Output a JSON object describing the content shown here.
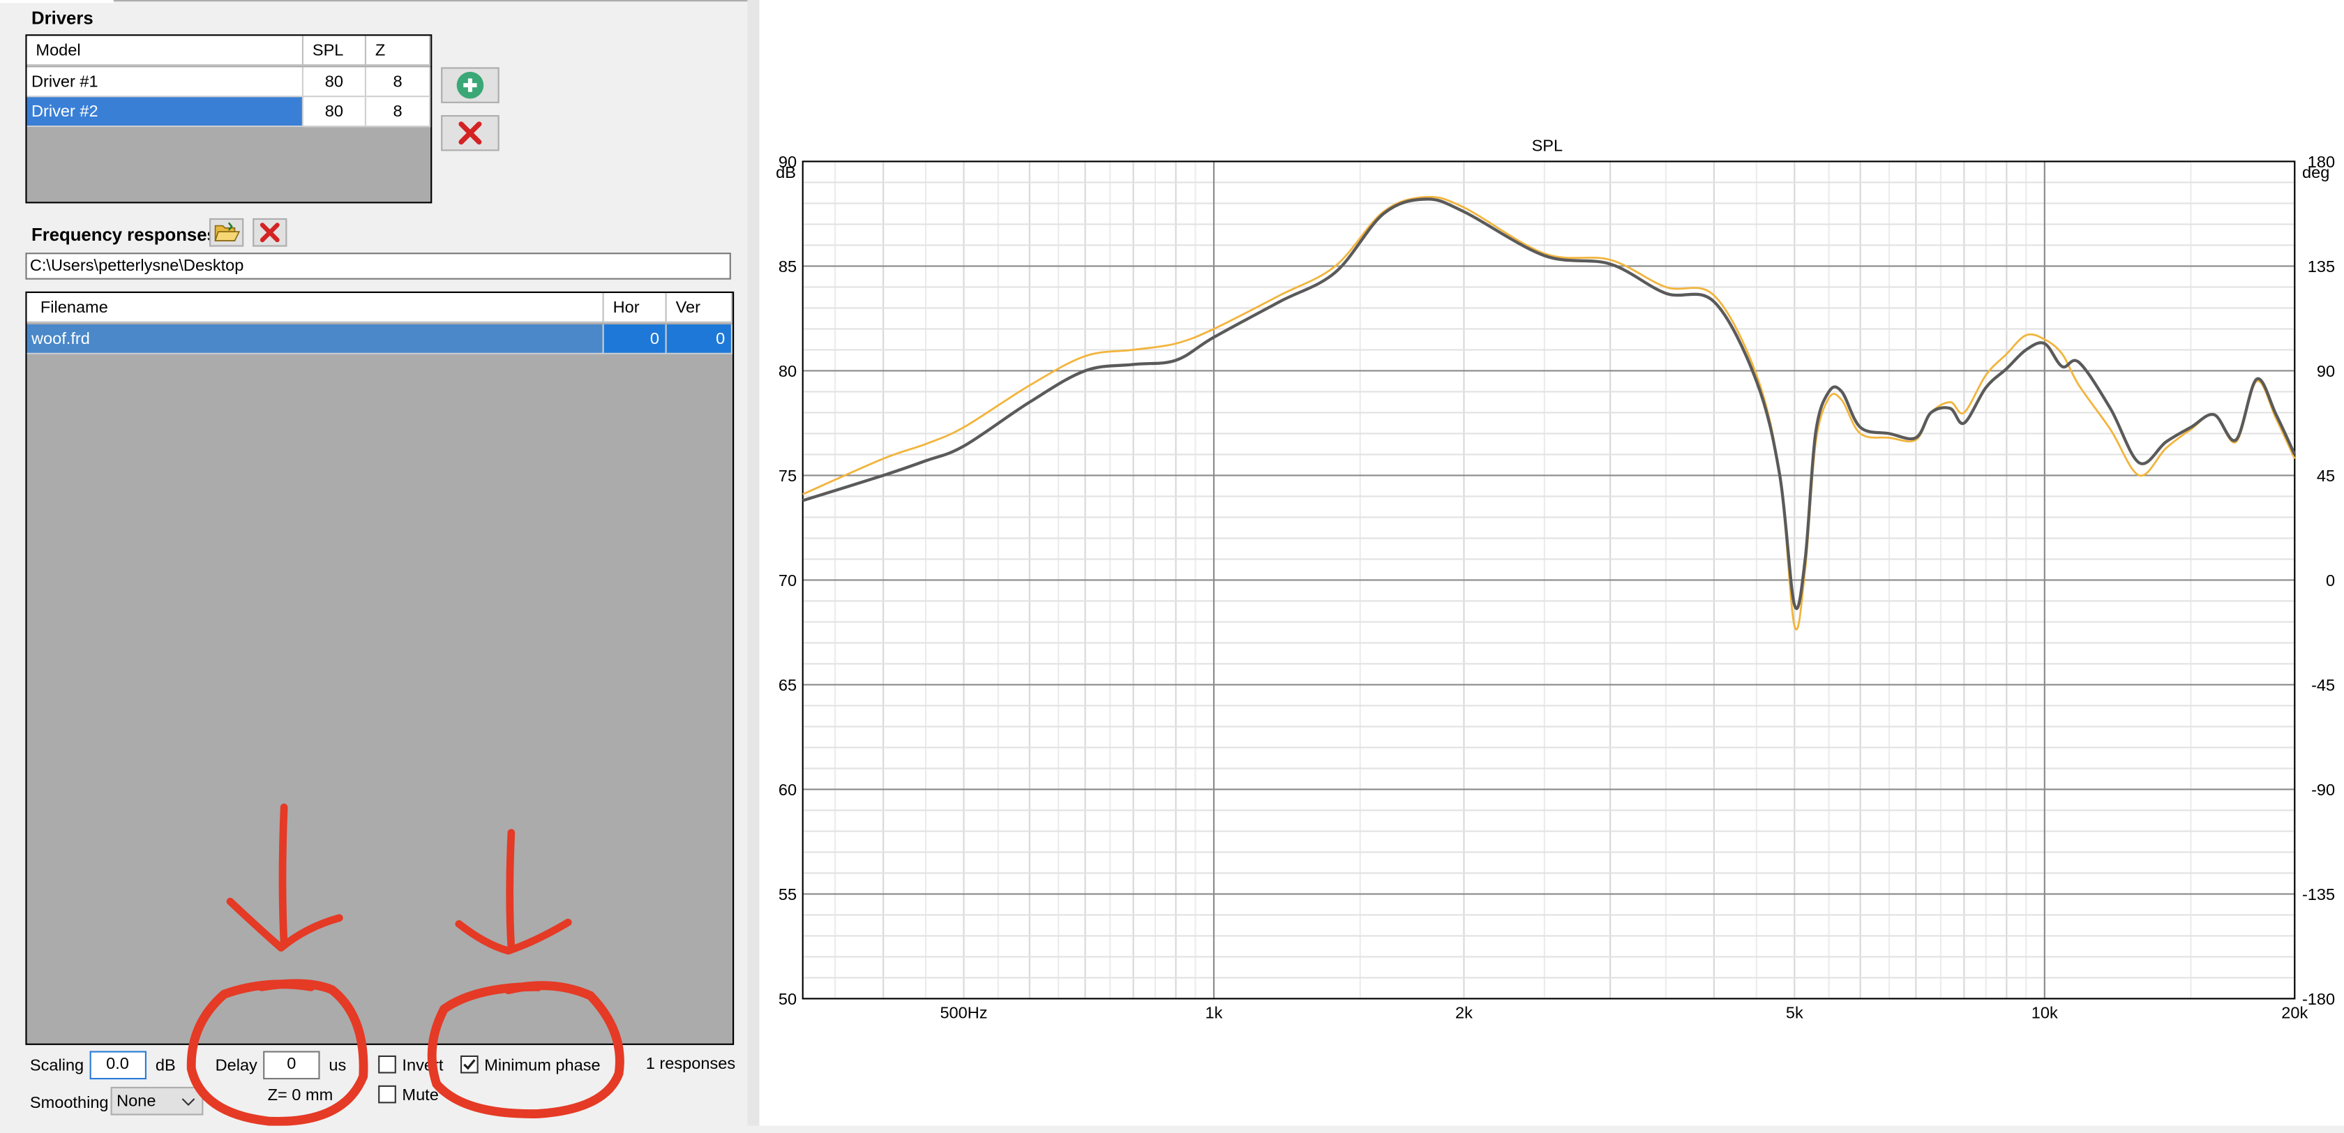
{
  "drivers": {
    "title": "Drivers",
    "columns": [
      "Model",
      "SPL",
      "Z"
    ],
    "rows": [
      {
        "model": "Driver #1",
        "spl": "80",
        "z": "8"
      },
      {
        "model": "Driver #2",
        "spl": "80",
        "z": "8"
      }
    ]
  },
  "freq": {
    "title": "Frequency responses",
    "path": "C:\\Users\\petterlysne\\Desktop",
    "columns": [
      "Filename",
      "Hor",
      "Ver"
    ],
    "rows": [
      {
        "filename": "woof.frd",
        "hor": "0",
        "ver": "0"
      }
    ]
  },
  "controls": {
    "scaling_label": "Scaling",
    "scaling_value": "0.0",
    "scaling_unit": "dB",
    "delay_label": "Delay",
    "delay_value": "0",
    "delay_unit": "us",
    "z_text": "Z= 0 mm",
    "invert_label": "Invert",
    "invert_checked": false,
    "mute_label": "Mute",
    "mute_checked": false,
    "minphase_label": "Minimum phase",
    "minphase_checked": true,
    "responses_text": "1 responses",
    "smoothing_label": "Smoothing",
    "smoothing_value": "None"
  },
  "chart_data": {
    "type": "line",
    "title": "SPL",
    "y_unit": "dB",
    "y2_unit": "deg",
    "xscale": "log",
    "xlim": [
      320,
      20000
    ],
    "ylim": [
      50,
      90
    ],
    "y2lim": [
      -180,
      180
    ],
    "y_ticks": [
      90,
      85,
      80,
      75,
      70,
      65,
      60,
      55,
      50
    ],
    "y2_ticks": [
      180,
      135,
      90,
      45,
      0,
      -45,
      -90,
      -135,
      -180
    ],
    "x_tick_labels": [
      {
        "v": 500,
        "label": "500Hz"
      },
      {
        "v": 1000,
        "label": "1k"
      },
      {
        "v": 2000,
        "label": "2k"
      },
      {
        "v": 5000,
        "label": "5k"
      },
      {
        "v": 10000,
        "label": "10k"
      },
      {
        "v": 20000,
        "label": "20k"
      }
    ],
    "grid": true,
    "series": [
      {
        "color": "#5a5a5a",
        "points": [
          [
            320,
            73.8
          ],
          [
            400,
            75
          ],
          [
            450,
            75.7
          ],
          [
            500,
            76.4
          ],
          [
            600,
            78.5
          ],
          [
            700,
            80
          ],
          [
            800,
            80.3
          ],
          [
            900,
            80.5
          ],
          [
            1000,
            81.6
          ],
          [
            1200,
            83.3
          ],
          [
            1400,
            84.7
          ],
          [
            1600,
            87.5
          ],
          [
            1800,
            88.2
          ],
          [
            2000,
            87.6
          ],
          [
            2500,
            85.5
          ],
          [
            3000,
            85.1
          ],
          [
            3500,
            83.7
          ],
          [
            4000,
            83.3
          ],
          [
            4500,
            79.5
          ],
          [
            4800,
            75
          ],
          [
            5000,
            68.8
          ],
          [
            5150,
            71
          ],
          [
            5300,
            77
          ],
          [
            5500,
            79
          ],
          [
            5700,
            79
          ],
          [
            6000,
            77.3
          ],
          [
            6500,
            77
          ],
          [
            7000,
            76.8
          ],
          [
            7300,
            78
          ],
          [
            7700,
            78.2
          ],
          [
            8000,
            77.5
          ],
          [
            8500,
            79.2
          ],
          [
            9000,
            80.1
          ],
          [
            9500,
            81
          ],
          [
            10000,
            81.3
          ],
          [
            10500,
            80.2
          ],
          [
            11000,
            80.4
          ],
          [
            12000,
            78.2
          ],
          [
            13000,
            75.6
          ],
          [
            14000,
            76.6
          ],
          [
            15000,
            77.3
          ],
          [
            16000,
            77.9
          ],
          [
            17000,
            76.7
          ],
          [
            18000,
            79.6
          ],
          [
            19000,
            77.9
          ],
          [
            20000,
            76
          ]
        ]
      },
      {
        "color": "#f2b43c",
        "points": [
          [
            320,
            74.1
          ],
          [
            400,
            75.8
          ],
          [
            450,
            76.5
          ],
          [
            500,
            77.3
          ],
          [
            600,
            79.3
          ],
          [
            700,
            80.7
          ],
          [
            800,
            81
          ],
          [
            900,
            81.3
          ],
          [
            1000,
            82
          ],
          [
            1200,
            83.6
          ],
          [
            1400,
            85
          ],
          [
            1600,
            87.6
          ],
          [
            1800,
            88.3
          ],
          [
            2000,
            87.8
          ],
          [
            2500,
            85.6
          ],
          [
            3000,
            85.3
          ],
          [
            3500,
            84
          ],
          [
            4000,
            83.6
          ],
          [
            4500,
            79.8
          ],
          [
            4800,
            75
          ],
          [
            5000,
            67.8
          ],
          [
            5150,
            70.5
          ],
          [
            5300,
            76.5
          ],
          [
            5500,
            78.7
          ],
          [
            5700,
            78.6
          ],
          [
            6000,
            77
          ],
          [
            6500,
            76.8
          ],
          [
            7000,
            76.7
          ],
          [
            7300,
            78
          ],
          [
            7700,
            78.5
          ],
          [
            8000,
            78
          ],
          [
            8500,
            79.8
          ],
          [
            9000,
            80.8
          ],
          [
            9500,
            81.7
          ],
          [
            10000,
            81.5
          ],
          [
            10500,
            80.8
          ],
          [
            11000,
            79.3
          ],
          [
            12000,
            77.2
          ],
          [
            13000,
            75
          ],
          [
            14000,
            76.3
          ],
          [
            15000,
            77.2
          ],
          [
            16000,
            77.9
          ],
          [
            17000,
            76.6
          ],
          [
            18000,
            79.5
          ],
          [
            19000,
            77.7
          ],
          [
            20000,
            75.8
          ]
        ]
      }
    ]
  }
}
